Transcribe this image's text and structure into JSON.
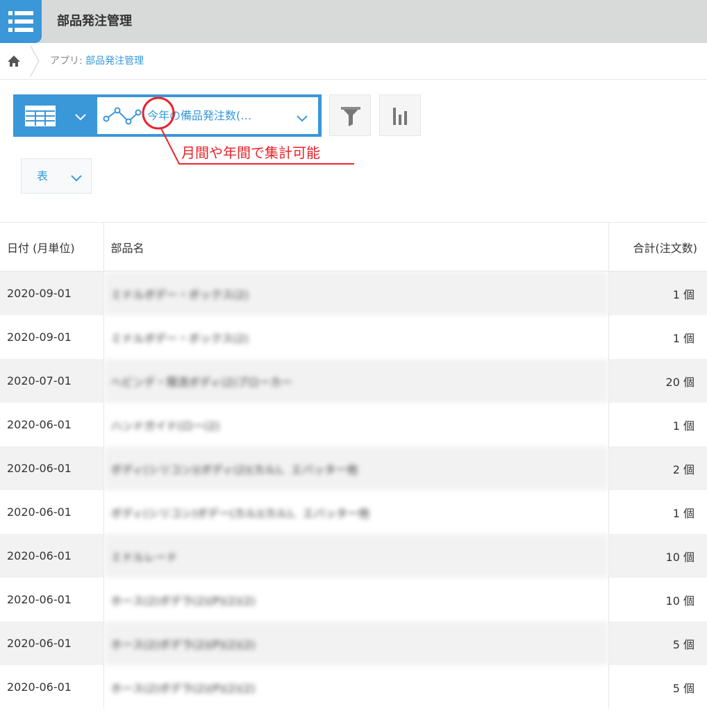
{
  "header": {
    "title": "部品発注管理"
  },
  "breadcrumb": {
    "prefix": "アプリ: ",
    "app_link": "部品発注管理"
  },
  "view_bar": {
    "graph_name": "今年の備品発注数(…"
  },
  "annotation": {
    "text": "月間や年間で集計可能",
    "color": "#e8232a"
  },
  "chart_type": {
    "selected": "表"
  },
  "table": {
    "headers": [
      "日付 (月単位)",
      "部品名",
      "合計(注文数)"
    ],
    "rows": [
      {
        "date": "2020-09-01",
        "name": "ミドルボデー・ボックス(2)",
        "total": "1 個"
      },
      {
        "date": "2020-09-01",
        "name": "ミドルボデー・ボックス(2)",
        "total": "1 個"
      },
      {
        "date": "2020-07-01",
        "name": "ヘビンデ・限流ボディ(2)ブローカー",
        "total": "20 個"
      },
      {
        "date": "2020-06-01",
        "name": "ハンドガイド(ロー(2)",
        "total": "1 個"
      },
      {
        "date": "2020-06-01",
        "name": "ボディ(シリコン)(ボディ(2)(カル)、エバッター他",
        "total": "2 個"
      },
      {
        "date": "2020-06-01",
        "name": "ボディ(シリコン)ボデー(カル)(カル)、エバッター他",
        "total": "1 個"
      },
      {
        "date": "2020-06-01",
        "name": "ミドルレード",
        "total": "10 個"
      },
      {
        "date": "2020-06-01",
        "name": "ホース(2)ボデラ(2)(P)(2)(2)",
        "total": "10 個"
      },
      {
        "date": "2020-06-01",
        "name": "ホース(2)ボデラ(2)(P)(2)(2)",
        "total": "5 個"
      },
      {
        "date": "2020-06-01",
        "name": "ホース(2)ボデラ(2)(P)(2)(2)",
        "total": "5 個"
      }
    ]
  },
  "colors": {
    "accent": "#3a97d8",
    "link": "#3498db",
    "header_bg": "#d8d9d9"
  }
}
